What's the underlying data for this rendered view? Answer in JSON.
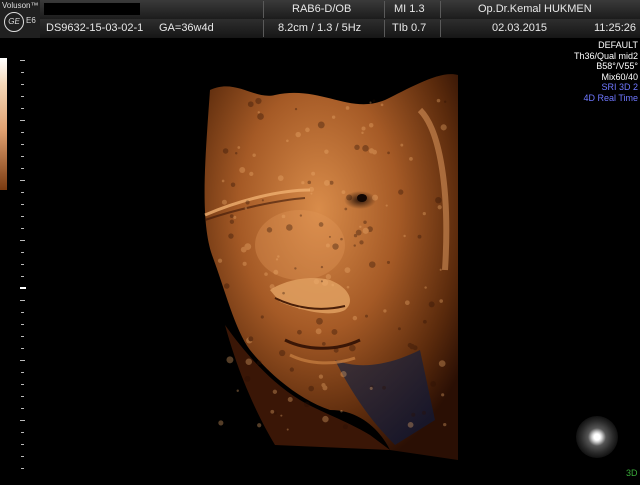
{
  "header": {
    "brand": "Voluson™",
    "model": "E6",
    "logo_text": "GE",
    "probe": "RAB6-D/OB",
    "mi": "MI  1.3",
    "operator": "Op.Dr.Kemal HUKMEN",
    "patient_id": "DS9632-15-03-02-1",
    "ga": "GA=36w4d",
    "depth_settings": "8.2cm / 1.3 /  5Hz",
    "tib": "TIb  0.7",
    "date": "02.03.2015",
    "time": "11:25:26"
  },
  "params": [
    "DEFAULT",
    "Th36/Qual mid2",
    "B58°/V55°",
    "Mix60/40"
  ],
  "params_blue": [
    "SRI 3D 2",
    "4D Real Time"
  ],
  "mode_label": "3D",
  "colors": {
    "render_dark": "#3a1606",
    "render_mid": "#8a4a20",
    "render_light": "#d98c4a",
    "blue_text": "#6f77ff",
    "bar_bg": "#2b2b2b"
  }
}
